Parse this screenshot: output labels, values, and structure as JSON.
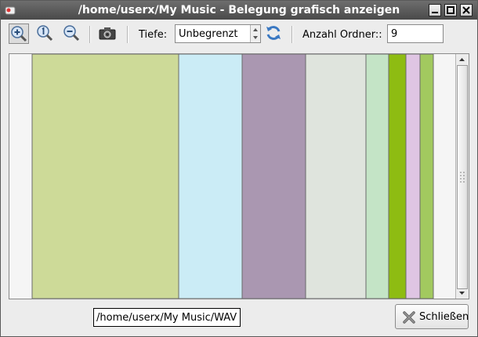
{
  "window": {
    "title": "/home/userx/My Music - Belegung grafisch anzeigen"
  },
  "toolbar": {
    "depth_label": "Tiefe:",
    "depth_value": "Unbegrenzt",
    "folder_count_label": "Anzahl Ordner::",
    "folder_count_value": "9"
  },
  "map": {
    "blocks": [
      {
        "color": "#cdda98"
      },
      {
        "color": "#cbecf6"
      },
      {
        "color": "#aa97b1"
      },
      {
        "color": "#dfe4dd"
      },
      {
        "color": "#c4e4c6"
      },
      {
        "color": "#8ebc12"
      },
      {
        "color": "#dfc5e3"
      },
      {
        "color": "#a2c95f"
      }
    ]
  },
  "tooltip": {
    "text": "/home/userx/My Music/WAV"
  },
  "footer": {
    "close_label": "Schließen"
  }
}
